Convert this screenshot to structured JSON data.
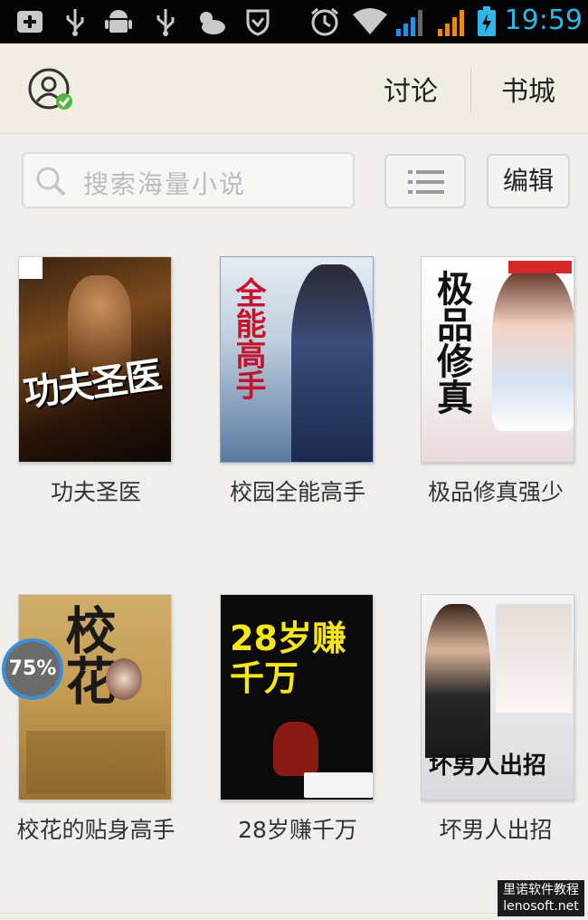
{
  "status_bar": {
    "time": "19:59",
    "time_color": "#2fb5e8",
    "left_icons": [
      "add-icon",
      "usb-icon",
      "android-icon",
      "usb-icon",
      "weather-icon",
      "shield-icon"
    ],
    "right_icons": [
      "alarm-icon",
      "wifi-icon",
      "signal-icon",
      "signal-icon",
      "battery-icon"
    ]
  },
  "header": {
    "tabs": [
      {
        "label": "讨论"
      },
      {
        "label": "书城"
      }
    ],
    "background": "#f1ede2"
  },
  "toolbar": {
    "search_placeholder": "搜索海量小说",
    "edit_label": "编辑"
  },
  "books": [
    {
      "title": "功夫圣医",
      "cover_text": "功夫圣医"
    },
    {
      "title": "校园全能高手",
      "cover_text": "全能高手"
    },
    {
      "title": "极品修真强少",
      "cover_text": "极品修真"
    },
    {
      "title": "校花的贴身高手",
      "cover_text": "校花",
      "progress": "75%"
    },
    {
      "title": "28岁赚千万",
      "cover_text": "28岁赚千万"
    },
    {
      "title": "坏男人出招",
      "cover_text": "坏男人出招"
    }
  ],
  "watermark": {
    "line1": "里诺软件教程",
    "line2": "lenosoft.net"
  }
}
